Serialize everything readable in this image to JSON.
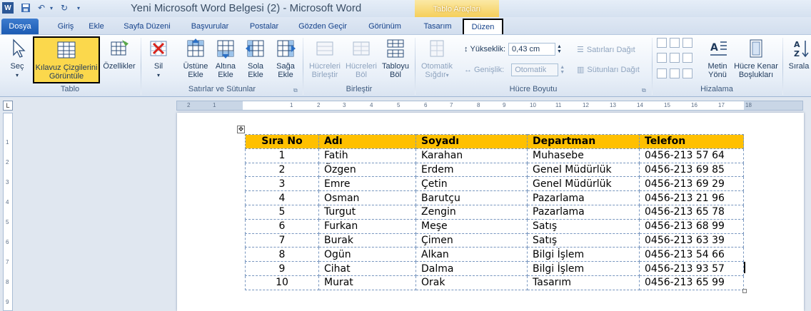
{
  "window": {
    "title": "Yeni Microsoft Word Belgesi (2)  -  Microsoft Word",
    "context_tab_group": "Tablo Araçları"
  },
  "tabs": [
    "Dosya",
    "Giriş",
    "Ekle",
    "Sayfa Düzeni",
    "Başvurular",
    "Postalar",
    "Gözden Geçir",
    "Görünüm",
    "Tasarım",
    "Düzen"
  ],
  "ribbon": {
    "tablo": {
      "label": "Tablo",
      "sec": "Seç",
      "kilavuz_line1": "Kılavuz Çizgilerini",
      "kilavuz_line2": "Görüntüle",
      "ozellikler": "Özellikler"
    },
    "satirlar": {
      "label": "Satırlar ve Sütunlar",
      "sil": "Sil",
      "ustune_1": "Üstüne",
      "ustune_2": "Ekle",
      "altina_1": "Altına",
      "altina_2": "Ekle",
      "sola_1": "Sola",
      "sola_2": "Ekle",
      "saga_1": "Sağa",
      "saga_2": "Ekle"
    },
    "birlestir": {
      "label": "Birleştir",
      "hucreleri_birlestir_1": "Hücreleri",
      "hucreleri_birlestir_2": "Birleştir",
      "hucreleri_bol_1": "Hücreleri",
      "hucreleri_bol_2": "Böl",
      "tabloyu_bol_1": "Tabloyu",
      "tabloyu_bol_2": "Böl"
    },
    "hucre_boyutu": {
      "label": "Hücre Boyutu",
      "otomatik_1": "Otomatik",
      "otomatik_2": "Sığdır",
      "yukseklik_label": "Yükseklik:",
      "yukseklik_value": "0,43 cm",
      "genislik_label": "Genişlik:",
      "genislik_value": "Otomatik",
      "satirlari_dagit": "Satırları Dağıt",
      "sutunlari_dagit": "Sütunları Dağıt"
    },
    "hizalama": {
      "label": "Hizalama",
      "metin_yonu_1": "Metin",
      "metin_yonu_2": "Yönü",
      "hucre_kenar_1": "Hücre Kenar",
      "hucre_kenar_2": "Boşlukları",
      "sirala": "Sırala"
    }
  },
  "ruler": {
    "h_marks": [
      "2",
      "1",
      "1",
      "2",
      "3",
      "4",
      "5",
      "6",
      "7",
      "8",
      "9",
      "10",
      "11",
      "12",
      "13",
      "14",
      "15",
      "16",
      "17",
      "18"
    ],
    "v_marks": [
      "1",
      "2",
      "3",
      "4",
      "5",
      "6",
      "7",
      "8",
      "9"
    ]
  },
  "table": {
    "headers": [
      "Sıra No",
      "Adı",
      "Soyadı",
      "Departman",
      "Telefon"
    ],
    "rows": [
      [
        "1",
        "Fatih",
        "Karahan",
        "Muhasebe",
        "0456-213 57 64"
      ],
      [
        "2",
        "Özgen",
        "Erdem",
        "Genel Müdürlük",
        "0456-213 69 85"
      ],
      [
        "3",
        "Emre",
        "Çetin",
        "Genel Müdürlük",
        "0456-213 69 29"
      ],
      [
        "4",
        "Osman",
        "Barutçu",
        "Pazarlama",
        "0456-213 21 96"
      ],
      [
        "5",
        "Turgut",
        "Zengin",
        "Pazarlama",
        "0456-213 65 78"
      ],
      [
        "6",
        "Furkan",
        "Meşe",
        "Satış",
        "0456-213 68 99"
      ],
      [
        "7",
        "Burak",
        "Çimen",
        "Satış",
        "0456-213 63 39"
      ],
      [
        "8",
        "Ogün",
        "Alkan",
        "Bilgi İşlem",
        "0456-213 54 66"
      ],
      [
        "9",
        "Cihat",
        "Dalma",
        "Bilgi İşlem",
        "0456-213 93 57"
      ],
      [
        "10",
        "Murat",
        "Orak",
        "Tasarım",
        "0456-213 65 99"
      ]
    ]
  },
  "colors": {
    "header_fill": "#ffc000",
    "grid_line": "#7896bf",
    "highlight": "#fbd84c"
  }
}
